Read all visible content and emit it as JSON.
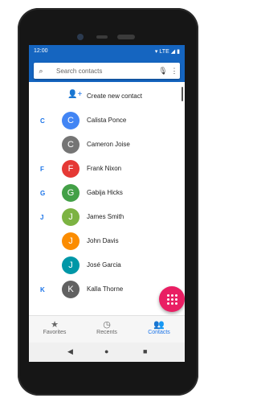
{
  "status": {
    "time": "12:00",
    "network": "LTE"
  },
  "search": {
    "placeholder": "Search contacts"
  },
  "create": {
    "label": "Create new contact"
  },
  "contacts": [
    {
      "letter": "C",
      "initial": "C",
      "name": "Calista Ponce",
      "color": "#4285f4"
    },
    {
      "letter": "",
      "initial": "C",
      "name": "Cameron Joise",
      "color": "#757575"
    },
    {
      "letter": "F",
      "initial": "F",
      "name": "Frank Nixon",
      "color": "#e53935"
    },
    {
      "letter": "G",
      "initial": "G",
      "name": "Gabija Hicks",
      "color": "#43a047"
    },
    {
      "letter": "J",
      "initial": "J",
      "name": "James Smith",
      "color": "#7cb342"
    },
    {
      "letter": "",
      "initial": "J",
      "name": "John Davis",
      "color": "#fb8c00"
    },
    {
      "letter": "",
      "initial": "J",
      "name": "José Garcia",
      "color": "#0097a7"
    },
    {
      "letter": "K",
      "initial": "K",
      "name": "Kalla Thorne",
      "color": "#616161"
    }
  ],
  "nav": {
    "favorites": "Favorites",
    "recents": "Recents",
    "contacts": "Contacts"
  },
  "colors": {
    "accent": "#1565c0",
    "fab": "#e91e63"
  }
}
